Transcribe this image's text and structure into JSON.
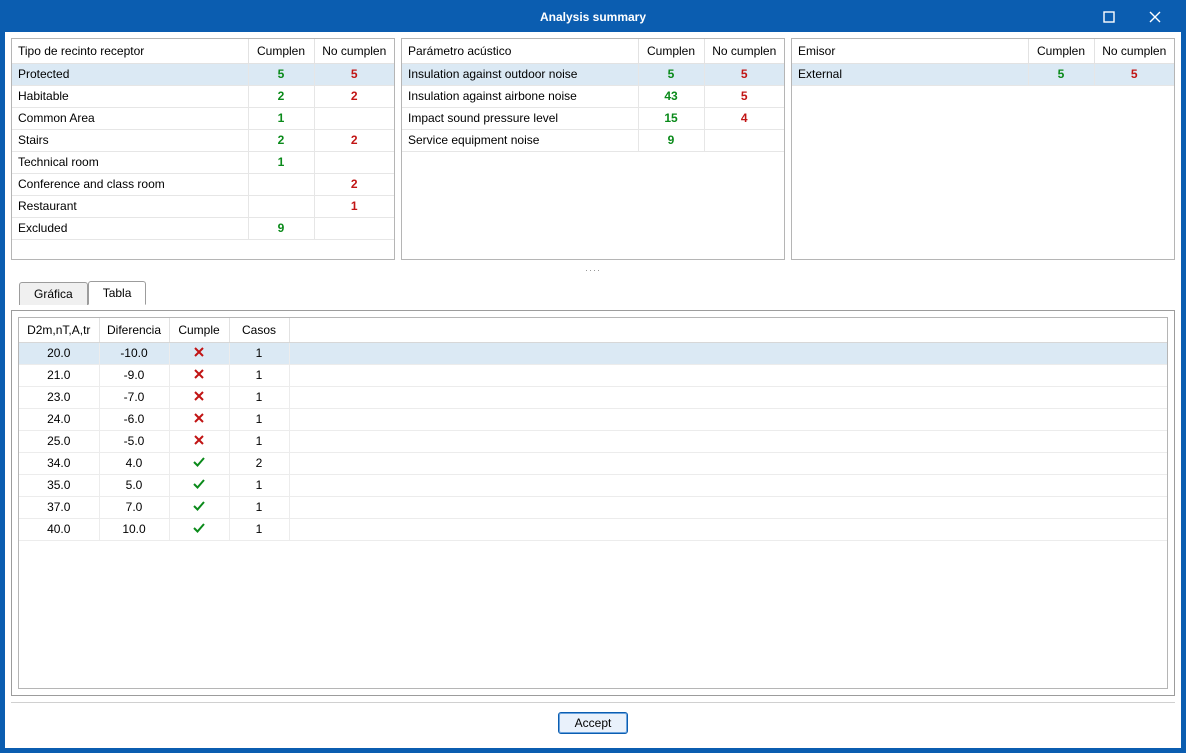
{
  "window": {
    "title": "Analysis summary"
  },
  "panels": {
    "receptor": {
      "headers": [
        "Tipo de recinto receptor",
        "Cumplen",
        "No cumplen"
      ],
      "rows": [
        {
          "name": "Protected",
          "pass": "5",
          "fail": "5",
          "selected": true
        },
        {
          "name": "Habitable",
          "pass": "2",
          "fail": "2"
        },
        {
          "name": "Common Area",
          "pass": "1",
          "fail": ""
        },
        {
          "name": "Stairs",
          "pass": "2",
          "fail": "2"
        },
        {
          "name": "Technical room",
          "pass": "1",
          "fail": ""
        },
        {
          "name": "Conference and class room",
          "pass": "",
          "fail": "2"
        },
        {
          "name": "Restaurant",
          "pass": "",
          "fail": "1"
        },
        {
          "name": "Excluded",
          "pass": "9",
          "fail": ""
        }
      ]
    },
    "param": {
      "headers": [
        "Parámetro acústico",
        "Cumplen",
        "No cumplen"
      ],
      "rows": [
        {
          "name": "Insulation against outdoor noise",
          "pass": "5",
          "fail": "5",
          "selected": true
        },
        {
          "name": "Insulation against airbone noise",
          "pass": "43",
          "fail": "5"
        },
        {
          "name": "Impact sound pressure level",
          "pass": "15",
          "fail": "4"
        },
        {
          "name": "Service equipment noise",
          "pass": "9",
          "fail": ""
        }
      ]
    },
    "emisor": {
      "headers": [
        "Emisor",
        "Cumplen",
        "No cumplen"
      ],
      "rows": [
        {
          "name": "External",
          "pass": "5",
          "fail": "5",
          "selected": true
        }
      ]
    }
  },
  "tabs": {
    "grafica": "Gráfica",
    "tabla": "Tabla",
    "active": "tabla"
  },
  "detail": {
    "headers": [
      "D2m,nT,A,tr",
      "Diferencia",
      "Cumple",
      "Casos"
    ],
    "rows": [
      {
        "v": "20.0",
        "d": "-10.0",
        "ok": false,
        "c": "1",
        "selected": true
      },
      {
        "v": "21.0",
        "d": "-9.0",
        "ok": false,
        "c": "1"
      },
      {
        "v": "23.0",
        "d": "-7.0",
        "ok": false,
        "c": "1"
      },
      {
        "v": "24.0",
        "d": "-6.0",
        "ok": false,
        "c": "1"
      },
      {
        "v": "25.0",
        "d": "-5.0",
        "ok": false,
        "c": "1"
      },
      {
        "v": "34.0",
        "d": "4.0",
        "ok": true,
        "c": "2"
      },
      {
        "v": "35.0",
        "d": "5.0",
        "ok": true,
        "c": "1"
      },
      {
        "v": "37.0",
        "d": "7.0",
        "ok": true,
        "c": "1"
      },
      {
        "v": "40.0",
        "d": "10.0",
        "ok": true,
        "c": "1"
      }
    ]
  },
  "footer": {
    "accept": "Accept"
  }
}
